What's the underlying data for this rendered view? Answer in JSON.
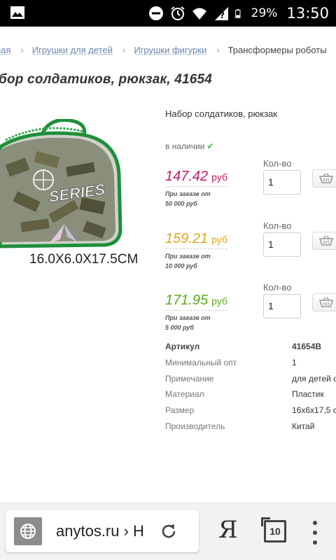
{
  "status_bar": {
    "battery": "29%",
    "time": "13:50"
  },
  "breadcrumb": {
    "items": [
      "ная",
      "Игрушки для детей",
      "Игрушки фигурки"
    ],
    "current": "Трансформеры роботы"
  },
  "page_title": "бор солдатиков, рюкзак, 41654",
  "product": {
    "name": "Набор солдатиков, рюкзак",
    "image_caption": "16.0X6.0X17.5CM",
    "image_logo": "SERIES",
    "stock": "в наличии",
    "qty_label": "Кол-во",
    "tiers": [
      {
        "price": "147.42",
        "currency": "руб",
        "note_line1": "При заказе от",
        "note_line2": "50 000 руб",
        "qty": "1",
        "color": "#c2186a"
      },
      {
        "price": "159.21",
        "currency": "руб",
        "note_line1": "При заказе от",
        "note_line2": "10 000 руб",
        "qty": "1",
        "color": "#e0a81c"
      },
      {
        "price": "171.95",
        "currency": "руб",
        "note_line1": "При заказе от",
        "note_line2": "5 000 руб",
        "qty": "1",
        "color": "#5cab1a"
      }
    ],
    "specs": [
      {
        "label": "Артикул",
        "value": "41654B"
      },
      {
        "label": "Минимальный опт",
        "value": "1"
      },
      {
        "label": "Примечание",
        "value": "для детей о"
      },
      {
        "label": "Материал",
        "value": "Пластик"
      },
      {
        "label": "Размер",
        "value": "16x6x17,5 с"
      },
      {
        "label": "Производитель",
        "value": "Китай"
      }
    ]
  },
  "browser": {
    "url": "anytos.ru › Н",
    "yandex_label": "Я",
    "tab_count": "10"
  }
}
